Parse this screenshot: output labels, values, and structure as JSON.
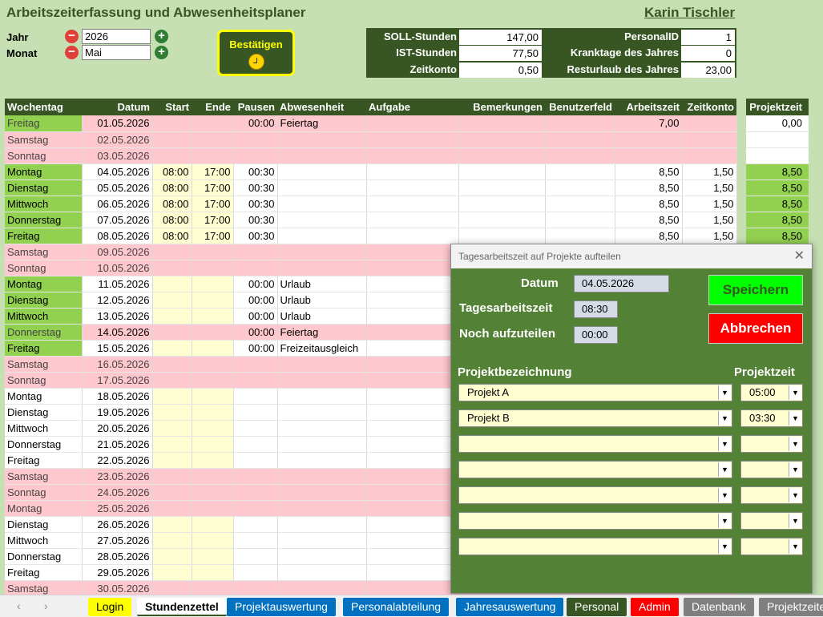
{
  "app": {
    "title": "Arbeitszeiterfassung und Abwesenheitsplaner",
    "user": "Karin  Tischler"
  },
  "selectors": {
    "year_label": "Jahr",
    "year_value": "2026",
    "month_label": "Monat",
    "month_value": "Mai"
  },
  "confirm_button": {
    "label": "Bestätigen"
  },
  "summary": {
    "soll_label": "SOLL-Stunden",
    "soll_value": "147,00",
    "ist_label": "IST-Stunden",
    "ist_value": "77,50",
    "konto_label": "Zeitkonto",
    "konto_value": "0,50",
    "pid_label": "PersonalID",
    "pid_value": "1",
    "krank_label": "Kranktage des Jahres",
    "krank_value": "0",
    "urlaub_label": "Resturlaub des Jahres",
    "urlaub_value": "23,00"
  },
  "grid": {
    "headers": [
      "Wochentag",
      "Datum",
      "Start",
      "Ende",
      "Pausen",
      "Abwesenheit",
      "Aufgabe",
      "Bemerkungen",
      "Benutzerfeld",
      "Arbeitszeit",
      "Zeitkonto"
    ],
    "rows": [
      {
        "type": "holiday",
        "day": "Freitag",
        "date": "01.05.2026",
        "start": "",
        "end": "",
        "pause": "00:00",
        "abs": "Feiertag",
        "az": "7,00",
        "zk": "",
        "yellow": false
      },
      {
        "type": "weekend",
        "day": "Samstag",
        "date": "02.05.2026",
        "start": "",
        "end": "",
        "pause": "",
        "abs": "",
        "az": "",
        "zk": "",
        "yellow": false
      },
      {
        "type": "weekend",
        "day": "Sonntag",
        "date": "03.05.2026",
        "start": "",
        "end": "",
        "pause": "",
        "abs": "",
        "az": "",
        "zk": "",
        "yellow": false
      },
      {
        "type": "work",
        "day": "Montag",
        "date": "04.05.2026",
        "start": "08:00",
        "end": "17:00",
        "pause": "00:30",
        "abs": "",
        "az": "8,50",
        "zk": "1,50",
        "yellow": true,
        "sep": true
      },
      {
        "type": "work",
        "day": "Dienstag",
        "date": "05.05.2026",
        "start": "08:00",
        "end": "17:00",
        "pause": "00:30",
        "abs": "",
        "az": "8,50",
        "zk": "1,50",
        "yellow": true
      },
      {
        "type": "work",
        "day": "Mittwoch",
        "date": "06.05.2026",
        "start": "08:00",
        "end": "17:00",
        "pause": "00:30",
        "abs": "",
        "az": "8,50",
        "zk": "1,50",
        "yellow": true
      },
      {
        "type": "work",
        "day": "Donnerstag",
        "date": "07.05.2026",
        "start": "08:00",
        "end": "17:00",
        "pause": "00:30",
        "abs": "",
        "az": "8,50",
        "zk": "1,50",
        "yellow": true
      },
      {
        "type": "work",
        "day": "Freitag",
        "date": "08.05.2026",
        "start": "08:00",
        "end": "17:00",
        "pause": "00:30",
        "abs": "",
        "az": "8,50",
        "zk": "1,50",
        "yellow": true
      },
      {
        "type": "weekend",
        "day": "Samstag",
        "date": "09.05.2026",
        "start": "",
        "end": "",
        "pause": "",
        "abs": "",
        "az": "",
        "zk": "",
        "yellow": false
      },
      {
        "type": "weekend",
        "day": "Sonntag",
        "date": "10.05.2026",
        "start": "",
        "end": "",
        "pause": "",
        "abs": "",
        "az": "",
        "zk": "",
        "yellow": false
      },
      {
        "type": "work",
        "day": "Montag",
        "date": "11.05.2026",
        "start": "",
        "end": "",
        "pause": "00:00",
        "abs": "Urlaub",
        "az": "",
        "zk": "",
        "yellow": true,
        "sep": true
      },
      {
        "type": "work",
        "day": "Dienstag",
        "date": "12.05.2026",
        "start": "",
        "end": "",
        "pause": "00:00",
        "abs": "Urlaub",
        "az": "",
        "zk": "",
        "yellow": true
      },
      {
        "type": "work",
        "day": "Mittwoch",
        "date": "13.05.2026",
        "start": "",
        "end": "",
        "pause": "00:00",
        "abs": "Urlaub",
        "az": "",
        "zk": "",
        "yellow": true
      },
      {
        "type": "holiday",
        "day": "Donnerstag",
        "date": "14.05.2026",
        "start": "",
        "end": "",
        "pause": "00:00",
        "abs": "Feiertag",
        "az": "",
        "zk": "",
        "yellow": true
      },
      {
        "type": "work",
        "day": "Freitag",
        "date": "15.05.2026",
        "start": "",
        "end": "",
        "pause": "00:00",
        "abs": "Freizeitausgleich",
        "az": "",
        "zk": "",
        "yellow": true
      },
      {
        "type": "weekend",
        "day": "Samstag",
        "date": "16.05.2026",
        "start": "",
        "end": "",
        "pause": "",
        "abs": "",
        "az": "",
        "zk": "",
        "yellow": false
      },
      {
        "type": "weekend",
        "day": "Sonntag",
        "date": "17.05.2026",
        "start": "",
        "end": "",
        "pause": "",
        "abs": "",
        "az": "",
        "zk": "",
        "yellow": false
      },
      {
        "type": "plain",
        "day": "Montag",
        "date": "18.05.2026",
        "start": "",
        "end": "",
        "pause": "",
        "abs": "",
        "az": "",
        "zk": "",
        "yellow": true,
        "sep": true
      },
      {
        "type": "plain",
        "day": "Dienstag",
        "date": "19.05.2026",
        "start": "",
        "end": "",
        "pause": "",
        "abs": "",
        "az": "",
        "zk": "",
        "yellow": true
      },
      {
        "type": "plain",
        "day": "Mittwoch",
        "date": "20.05.2026",
        "start": "",
        "end": "",
        "pause": "",
        "abs": "",
        "az": "",
        "zk": "",
        "yellow": true
      },
      {
        "type": "plain",
        "day": "Donnerstag",
        "date": "21.05.2026",
        "start": "",
        "end": "",
        "pause": "",
        "abs": "",
        "az": "",
        "zk": "",
        "yellow": true
      },
      {
        "type": "plain",
        "day": "Freitag",
        "date": "22.05.2026",
        "start": "",
        "end": "",
        "pause": "",
        "abs": "",
        "az": "",
        "zk": "",
        "yellow": true
      },
      {
        "type": "weekend",
        "day": "Samstag",
        "date": "23.05.2026",
        "start": "",
        "end": "",
        "pause": "",
        "abs": "",
        "az": "",
        "zk": "",
        "yellow": false
      },
      {
        "type": "weekend",
        "day": "Sonntag",
        "date": "24.05.2026",
        "start": "",
        "end": "",
        "pause": "",
        "abs": "",
        "az": "",
        "zk": "",
        "yellow": false
      },
      {
        "type": "weekend",
        "day": "Montag",
        "date": "25.05.2026",
        "start": "",
        "end": "",
        "pause": "",
        "abs": "",
        "az": "",
        "zk": "",
        "yellow": false,
        "sep": true
      },
      {
        "type": "plain",
        "day": "Dienstag",
        "date": "26.05.2026",
        "start": "",
        "end": "",
        "pause": "",
        "abs": "",
        "az": "",
        "zk": "",
        "yellow": true
      },
      {
        "type": "plain",
        "day": "Mittwoch",
        "date": "27.05.2026",
        "start": "",
        "end": "",
        "pause": "",
        "abs": "",
        "az": "",
        "zk": "",
        "yellow": true
      },
      {
        "type": "plain",
        "day": "Donnerstag",
        "date": "28.05.2026",
        "start": "",
        "end": "",
        "pause": "",
        "abs": "",
        "az": "",
        "zk": "",
        "yellow": true
      },
      {
        "type": "plain",
        "day": "Freitag",
        "date": "29.05.2026",
        "start": "",
        "end": "",
        "pause": "",
        "abs": "",
        "az": "",
        "zk": "",
        "yellow": true
      },
      {
        "type": "weekend",
        "day": "Samstag",
        "date": "30.05.2026",
        "start": "",
        "end": "",
        "pause": "",
        "abs": "",
        "az": "",
        "zk": "",
        "yellow": false
      }
    ]
  },
  "projektzeit": {
    "header": "Projektzeit",
    "values": [
      {
        "v": "0,00",
        "g": false
      },
      {
        "v": "",
        "g": false
      },
      {
        "v": "",
        "g": false
      },
      {
        "v": "8,50",
        "g": true
      },
      {
        "v": "8,50",
        "g": true
      },
      {
        "v": "8,50",
        "g": true
      },
      {
        "v": "8,50",
        "g": true
      },
      {
        "v": "8,50",
        "g": true
      }
    ]
  },
  "dialog": {
    "title": "Tagesarbeitszeit auf Projekte aufteilen",
    "datum_label": "Datum",
    "datum_value": "04.05.2026",
    "tag_label": "Tagesarbeitszeit",
    "tag_value": "08:30",
    "noch_label": "Noch aufzuteilen",
    "noch_value": "00:00",
    "save_label": "Speichern",
    "cancel_label": "Abbrechen",
    "proj_header": "Projektbezeichnung",
    "time_header": "Projektzeit",
    "rows": [
      {
        "name": "Projekt A",
        "time": "05:00"
      },
      {
        "name": "Projekt B",
        "time": "03:30"
      },
      {
        "name": "",
        "time": ""
      },
      {
        "name": "",
        "time": ""
      },
      {
        "name": "",
        "time": ""
      },
      {
        "name": "",
        "time": ""
      },
      {
        "name": "",
        "time": ""
      }
    ]
  },
  "tabs": [
    {
      "label": "Login",
      "bg": "#ffff00",
      "fg": "#000"
    },
    {
      "label": "Stundenzettel",
      "bg": "#ffffff",
      "fg": "#000",
      "active": true
    },
    {
      "label": "Projektauswertung",
      "bg": "#0070c0",
      "fg": "#fff"
    },
    {
      "label": "Personalabteilung",
      "bg": "#0070c0",
      "fg": "#fff"
    },
    {
      "label": "Jahresauswertung",
      "bg": "#0070c0",
      "fg": "#fff"
    },
    {
      "label": "Personal",
      "bg": "#375623",
      "fg": "#fff"
    },
    {
      "label": "Admin",
      "bg": "#ff0000",
      "fg": "#fff"
    },
    {
      "label": "Datenbank",
      "bg": "#7f7f7f",
      "fg": "#fff"
    },
    {
      "label": "Projektzeiten",
      "bg": "#7f7f7f",
      "fg": "#fff"
    }
  ],
  "icons": {
    "minus": "minus-icon",
    "plus": "plus-icon",
    "clock": "clock-icon",
    "close": "close-icon",
    "dropdown": "chevron-down-icon",
    "nav_prev": "chevron-left-icon",
    "nav_next": "chevron-right-icon"
  }
}
